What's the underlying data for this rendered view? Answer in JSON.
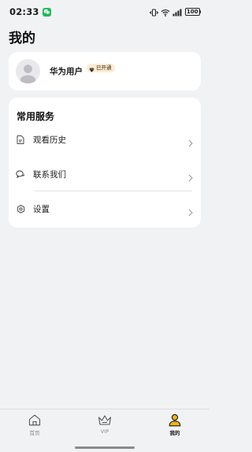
{
  "status_bar": {
    "time": "02:33",
    "battery": "100"
  },
  "page": {
    "title": "我的"
  },
  "profile": {
    "name": "华为用户",
    "vip_status": "已开通"
  },
  "services": {
    "title": "常用服务",
    "items": [
      {
        "label": "观看历史",
        "icon": "history-document-icon"
      },
      {
        "label": "联系我们",
        "icon": "chat-bubbles-icon"
      },
      {
        "label": "设置",
        "icon": "gear-icon"
      }
    ]
  },
  "tab_bar": {
    "tabs": [
      {
        "label": "首页",
        "icon": "home-icon",
        "active": false
      },
      {
        "label": "VIP",
        "icon": "crown-icon",
        "active": false
      },
      {
        "label": "我的",
        "icon": "person-icon",
        "active": true
      }
    ]
  },
  "colors": {
    "background": "#f1f2f4",
    "card": "#ffffff",
    "vip_badge_bg": "#fbecd3",
    "active_tab_accent": "#f3b21b",
    "wechat_green": "#1fb955"
  }
}
